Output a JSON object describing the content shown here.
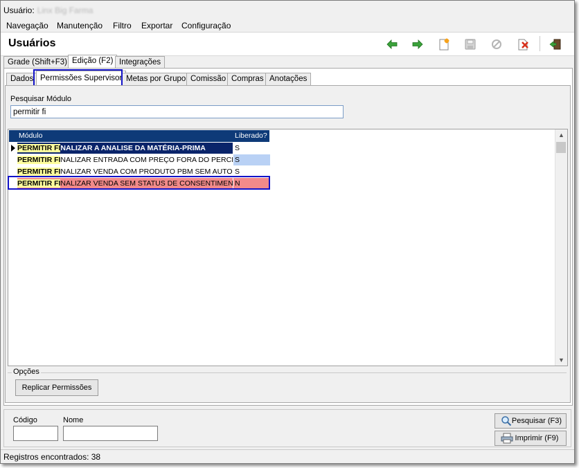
{
  "user": {
    "label": "Usuário:",
    "name": "Linx Big Farma"
  },
  "menu": [
    {
      "label": "Navegação"
    },
    {
      "label": "Manutenção"
    },
    {
      "label": "Filtro"
    },
    {
      "label": "Exportar"
    },
    {
      "label": "Configuração"
    }
  ],
  "page_title": "Usuários",
  "toolbar": {
    "icons": [
      "arrow-left-icon",
      "arrow-right-icon",
      "new-document-icon",
      "save-icon",
      "cancel-icon",
      "delete-icon",
      "exit-icon"
    ]
  },
  "outer_tabs": [
    {
      "label": "Grade (Shift+F3)"
    },
    {
      "label": "Edição (F2)"
    },
    {
      "label": "Integrações"
    }
  ],
  "inner_tabs": [
    {
      "label": "Dados"
    },
    {
      "label": "Permissões Supervisor"
    },
    {
      "label": "Metas por Grupo"
    },
    {
      "label": "Comissão"
    },
    {
      "label": "Compras"
    },
    {
      "label": "Anotações"
    }
  ],
  "search": {
    "label": "Pesquisar Módulo",
    "value": "permitir fi"
  },
  "grid": {
    "columns": [
      "Módulo",
      "Liberado?"
    ],
    "rows": [
      {
        "highlight": "PERMITIR FI",
        "rest": "NALIZAR A ANALISE DA MATÉRIA-PRIMA",
        "liberado": "S"
      },
      {
        "highlight": "PERMITIR FI",
        "rest": "NALIZAR ENTRADA COM PREÇO FORA DO PERCENTUAL",
        "liberado": "S"
      },
      {
        "highlight": "PERMITIR FI",
        "rest": "NALIZAR VENDA COM PRODUTO PBM SEM AUTORIZAÇÃO",
        "liberado": "S"
      },
      {
        "highlight": "PERMITIR FI",
        "rest": "NALIZAR VENDA SEM STATUS DE CONSENTIMENTO",
        "liberado": "N"
      }
    ]
  },
  "options": {
    "label": "Opções",
    "replicate_button": "Replicar Permissões"
  },
  "footer": {
    "code_label": "Código",
    "name_label": "Nome",
    "search_button": "Pesquisar (F3)",
    "print_button": "Imprimir (F9)"
  },
  "status": "Registros encontrados: 38",
  "colors": {
    "header": "#0e3a78",
    "selected_row": "#0a246a",
    "highlight": "#ffff9e",
    "row2_bg": "#b9d1f5",
    "row4_bg": "#f28a8a",
    "callout": "#1212c8"
  }
}
